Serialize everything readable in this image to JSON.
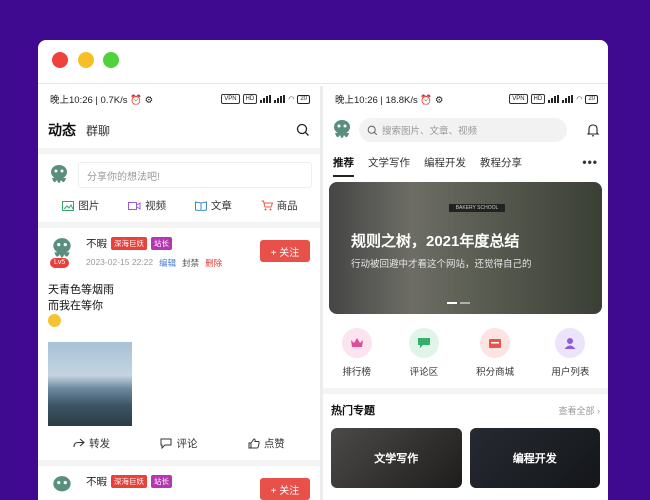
{
  "left": {
    "status": {
      "time": "晚上10:26",
      "speed": "0.7K/s",
      "vpn": "VPN",
      "hd": "HD",
      "battery": "20"
    },
    "header": {
      "title": "动态",
      "tab2": "群聊"
    },
    "compose": {
      "placeholder": "分享你的想法吧!",
      "actions": [
        {
          "label": "图片",
          "icon": "image-icon"
        },
        {
          "label": "视频",
          "icon": "video-icon"
        },
        {
          "label": "文章",
          "icon": "book-icon"
        },
        {
          "label": "商品",
          "icon": "cart-icon"
        }
      ]
    },
    "post": {
      "author": "不暇",
      "badge1": "深海巨妖",
      "badge2": "站长",
      "level": "Lv5",
      "date": "2023-02-15 22:22",
      "edit": "编辑",
      "ban": "封禁",
      "del": "删除",
      "follow": "+ 关注",
      "lines": [
        "天青色等烟雨",
        "而我在等你"
      ],
      "actions": {
        "share": "转发",
        "comment": "评论",
        "like": "点赞"
      }
    },
    "post2": {
      "author": "不暇",
      "badge1": "深海巨妖",
      "badge2": "站长",
      "follow": "+ 关注"
    }
  },
  "right": {
    "status": {
      "time": "晚上10:26",
      "speed": "18.8K/s",
      "vpn": "VPN",
      "hd": "HD",
      "battery": "20"
    },
    "search_placeholder": "搜索图片、文章、视频",
    "tabs": [
      "推荐",
      "文学写作",
      "编程开发",
      "教程分享"
    ],
    "banner": {
      "title": "规则之树，2021年度总结",
      "subtitle": "行动被回避中才看这个网站，还觉得自己的",
      "sign": "BAKERY SCHOOL"
    },
    "grid": [
      {
        "label": "排行榜",
        "icon": "crown-icon",
        "bg": "#fbe3ef",
        "fg": "#e24a9a"
      },
      {
        "label": "评论区",
        "icon": "chat-icon",
        "bg": "#e0f4e8",
        "fg": "#35b06a"
      },
      {
        "label": "积分商城",
        "icon": "shop-icon",
        "bg": "#fde3e2",
        "fg": "#e8544c"
      },
      {
        "label": "用户列表",
        "icon": "user-icon",
        "bg": "#ece4fb",
        "fg": "#8b5cdb"
      }
    ],
    "hot": {
      "title": "热门专题",
      "all": "查看全部",
      "cards": [
        "文学写作",
        "编程开发"
      ]
    }
  }
}
